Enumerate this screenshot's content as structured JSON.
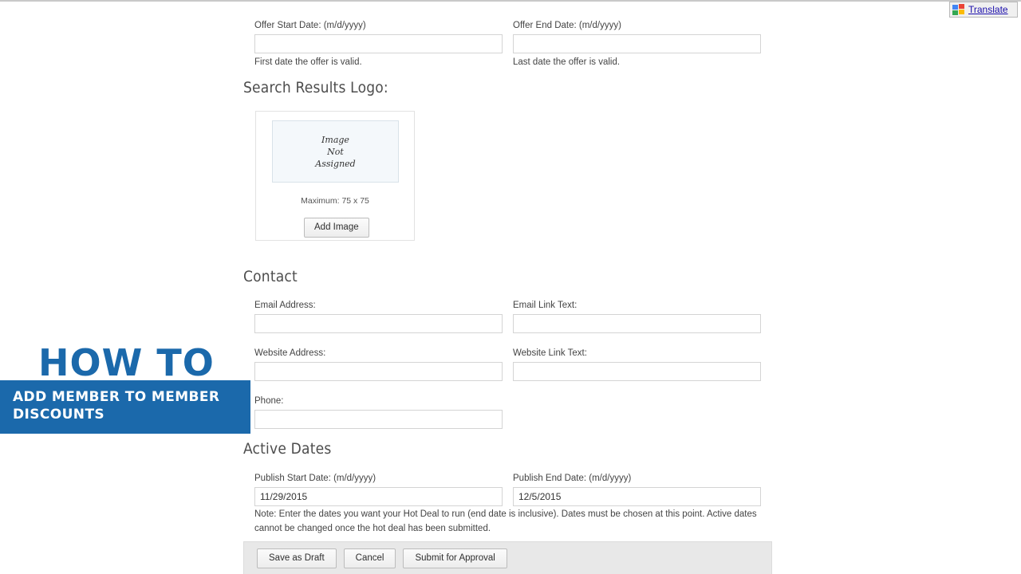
{
  "translate": {
    "icon": "google-translate-icon",
    "label": "Translate"
  },
  "offer_dates": {
    "start": {
      "label": "Offer Start Date: (m/d/yyyy)",
      "value": "",
      "help": "First date the offer is valid."
    },
    "end": {
      "label": "Offer End Date: (m/d/yyyy)",
      "value": "",
      "help": "Last date the offer is valid."
    }
  },
  "logo_section": {
    "heading": "Search Results Logo:",
    "placeholder_line1": "Image",
    "placeholder_line2": "Not",
    "placeholder_line3": "Assigned",
    "maximum_text": "Maximum: 75 x 75",
    "add_image_label": "Add Image"
  },
  "contact": {
    "heading": "Contact",
    "email_address": {
      "label": "Email Address:",
      "value": ""
    },
    "email_link_text": {
      "label": "Email Link Text:",
      "value": ""
    },
    "website_address": {
      "label": "Website Address:",
      "value": ""
    },
    "website_link_text": {
      "label": "Website Link Text:",
      "value": ""
    },
    "phone": {
      "label": "Phone:",
      "value": ""
    }
  },
  "active_dates": {
    "heading": "Active Dates",
    "publish_start": {
      "label": "Publish Start Date: (m/d/yyyy)",
      "value": "11/29/2015"
    },
    "publish_end": {
      "label": "Publish End Date: (m/d/yyyy)",
      "value": "12/5/2015"
    },
    "note": "Note: Enter the dates you want your Hot Deal to run (end date is inclusive). Dates must be chosen at this point. Active dates cannot be changed once the hot deal has been submitted."
  },
  "footer": {
    "save_draft_label": "Save as Draft",
    "cancel_label": "Cancel",
    "submit_label": "Submit for Approval"
  },
  "overlay": {
    "title": "HOW TO",
    "subtitle": "ADD MEMBER TO MEMBER DISCOUNTS",
    "accent_color": "#1b69ab"
  }
}
